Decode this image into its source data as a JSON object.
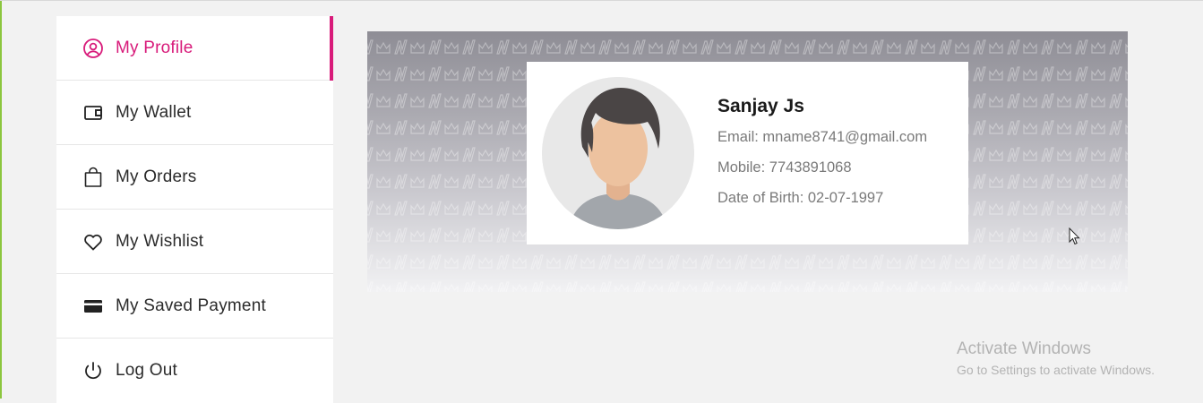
{
  "sidebar": {
    "items": [
      {
        "label": "My Profile",
        "icon": "user-circle-icon",
        "active": true
      },
      {
        "label": "My Wallet",
        "icon": "wallet-icon",
        "active": false
      },
      {
        "label": "My Orders",
        "icon": "shopping-bag-icon",
        "active": false
      },
      {
        "label": "My Wishlist",
        "icon": "heart-icon",
        "active": false
      },
      {
        "label": "My Saved Payment",
        "icon": "credit-card-icon",
        "active": false
      },
      {
        "label": "Log Out",
        "icon": "power-icon",
        "active": false
      }
    ],
    "accent_color": "#d81b7a"
  },
  "profile": {
    "name": "Sanjay Js",
    "email": "Email: mname8741@gmail.com",
    "mobile": "Mobile: 7743891068",
    "dob": "Date of Birth: 02-07-1997",
    "avatar_icon": "default-avatar-icon"
  },
  "watermark": {
    "title": "Activate Windows",
    "subtitle": "Go to Settings to activate Windows."
  }
}
